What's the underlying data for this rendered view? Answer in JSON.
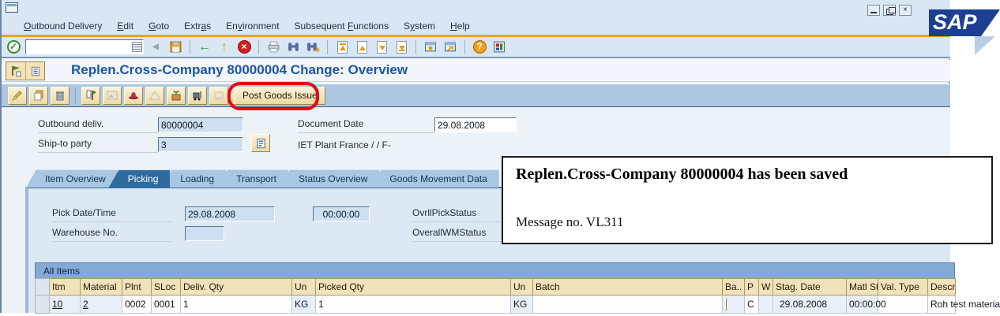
{
  "colors": {
    "sap_logo_blue": "#1c3f94",
    "annotation_red": "#e30613",
    "title_blue": "#1f55a8"
  },
  "window": {
    "logo_text": "SAP",
    "close_glyph": "×"
  },
  "menu_bar": {
    "items": [
      {
        "pre": "",
        "accel": "O",
        "post": "utbound Delivery"
      },
      {
        "pre": "",
        "accel": "E",
        "post": "dit"
      },
      {
        "pre": "",
        "accel": "G",
        "post": "oto"
      },
      {
        "pre": "Extr",
        "accel": "a",
        "post": "s"
      },
      {
        "pre": "En",
        "accel": "v",
        "post": "ironment"
      },
      {
        "pre": "Subsequent ",
        "accel": "F",
        "post": "unctions"
      },
      {
        "pre": "S",
        "accel": "y",
        "post": "stem"
      },
      {
        "pre": "",
        "accel": "H",
        "post": "elp"
      }
    ]
  },
  "toolbar": {
    "command_value": ""
  },
  "icons": {
    "enter": "✓",
    "collapse": "◀",
    "back": "←",
    "exit": "↑",
    "cancel": "×",
    "help": "?",
    "shortcut_arrow": "↗"
  },
  "header": {
    "title": "Replen.Cross-Company 80000004 Change: Overview"
  },
  "app_toolbar": {
    "post_goods_issue": "Post Goods Issue"
  },
  "form": {
    "outbound_deliv": {
      "label": "Outbound deliv.",
      "value": "80000004"
    },
    "ship_to_party": {
      "label": "Ship-to party",
      "value": "3"
    },
    "document_date": {
      "label": "Document Date",
      "value": "29.08.2008"
    },
    "plant_text": "IET Plant France / / F-"
  },
  "tab_strip": {
    "active_tab": "Picking",
    "tabs": [
      {
        "label": "Item Overview"
      },
      {
        "label": "Picking"
      },
      {
        "label": "Loading"
      },
      {
        "label": "Transport"
      },
      {
        "label": "Status Overview"
      },
      {
        "label": "Goods Movement Data"
      }
    ]
  },
  "picking_panel": {
    "pick_date_label": "Pick Date/Time",
    "pick_date": "29.08.2008",
    "pick_time": "00:00:00",
    "warehouse_label": "Warehouse No.",
    "warehouse_value": "",
    "ovrll_pick_status_label": "OvrllPickStatus",
    "overall_wm_status_label": "OverallWMStatus"
  },
  "message_box": {
    "line1": "Replen.Cross-Company 80000004 has been saved",
    "line2": "Message no. VL311"
  },
  "items_table": {
    "caption": "All Items",
    "columns": [
      "Itm",
      "Material",
      "Plnt",
      "SLoc",
      "Deliv. Qty",
      "Un",
      "Picked Qty",
      "Un",
      "Batch",
      "Ba..",
      "P",
      "W",
      "Stag. Date",
      "Matl Sta..",
      "Val. Type",
      "Description"
    ],
    "rows": [
      [
        "10",
        "2",
        "0002",
        "0001",
        "1",
        "KG",
        "1",
        "KG",
        "",
        "",
        "C",
        "",
        "29.08.2008",
        "00:00:00",
        "",
        "Roh test material"
      ]
    ]
  }
}
